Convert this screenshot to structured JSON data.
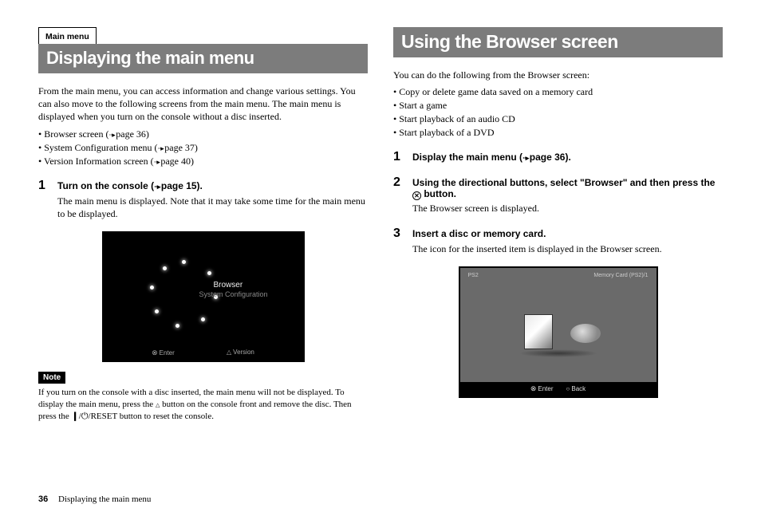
{
  "footer": {
    "page_number": "36",
    "title": "Displaying the main menu"
  },
  "left": {
    "crumb": "Main menu",
    "heading": "Displaying the main menu",
    "intro": "From the main menu, you can access information and change various settings. You can also move to the following screens from the main menu. The main menu is displayed when you turn on the console without a disc inserted.",
    "bullets": {
      "b1_pre": "• Browser screen (",
      "b1_ref": "page 36)",
      "b2_pre": "• System Configuration menu (",
      "b2_ref": "page 37)",
      "b3_pre": "• Version Information screen (",
      "b3_ref": "page 40)"
    },
    "step1": {
      "num": "1",
      "title_pre": "Turn on the console (",
      "title_ref": "page 15).",
      "body": "The main menu is displayed. Note that it may take some time for the main menu to be displayed."
    },
    "shot": {
      "browser": "Browser",
      "sysconf": "System Configuration",
      "enter": "Enter",
      "version": "Version"
    },
    "note_label": "Note",
    "note_a": "If you turn on the console with a disc inserted, the main menu will not be displayed. To display the main menu, press the ",
    "note_b": " button on the console front and remove the disc. Then press the ",
    "note_c": "/RESET button to reset the console."
  },
  "right": {
    "heading": "Using the Browser screen",
    "intro": "You can do the following from the Browser screen:",
    "bullets": {
      "b1": "• Copy or delete game data saved on a memory card",
      "b2": "• Start a game",
      "b3": "• Start playback of an audio CD",
      "b4": "• Start playback of a DVD"
    },
    "step1": {
      "num": "1",
      "title_pre": "Display the main menu (",
      "title_ref": "page 36)."
    },
    "step2": {
      "num": "2",
      "title_a": "Using the directional buttons, select \"Browser\" and then press the ",
      "title_b": " button.",
      "body": "The Browser screen is displayed."
    },
    "step3": {
      "num": "3",
      "title": "Insert a disc or memory card.",
      "body": "The icon for the inserted item is displayed in the Browser screen."
    },
    "shot": {
      "ps2": "PS2",
      "mc": "Memory Card (PS2)/1",
      "enter": "Enter",
      "back": "Back"
    }
  },
  "glyphs": {
    "arrow": "⋅⋅▸ ",
    "x": "✕",
    "eject": "",
    "pipe": "❙",
    "power": ""
  }
}
